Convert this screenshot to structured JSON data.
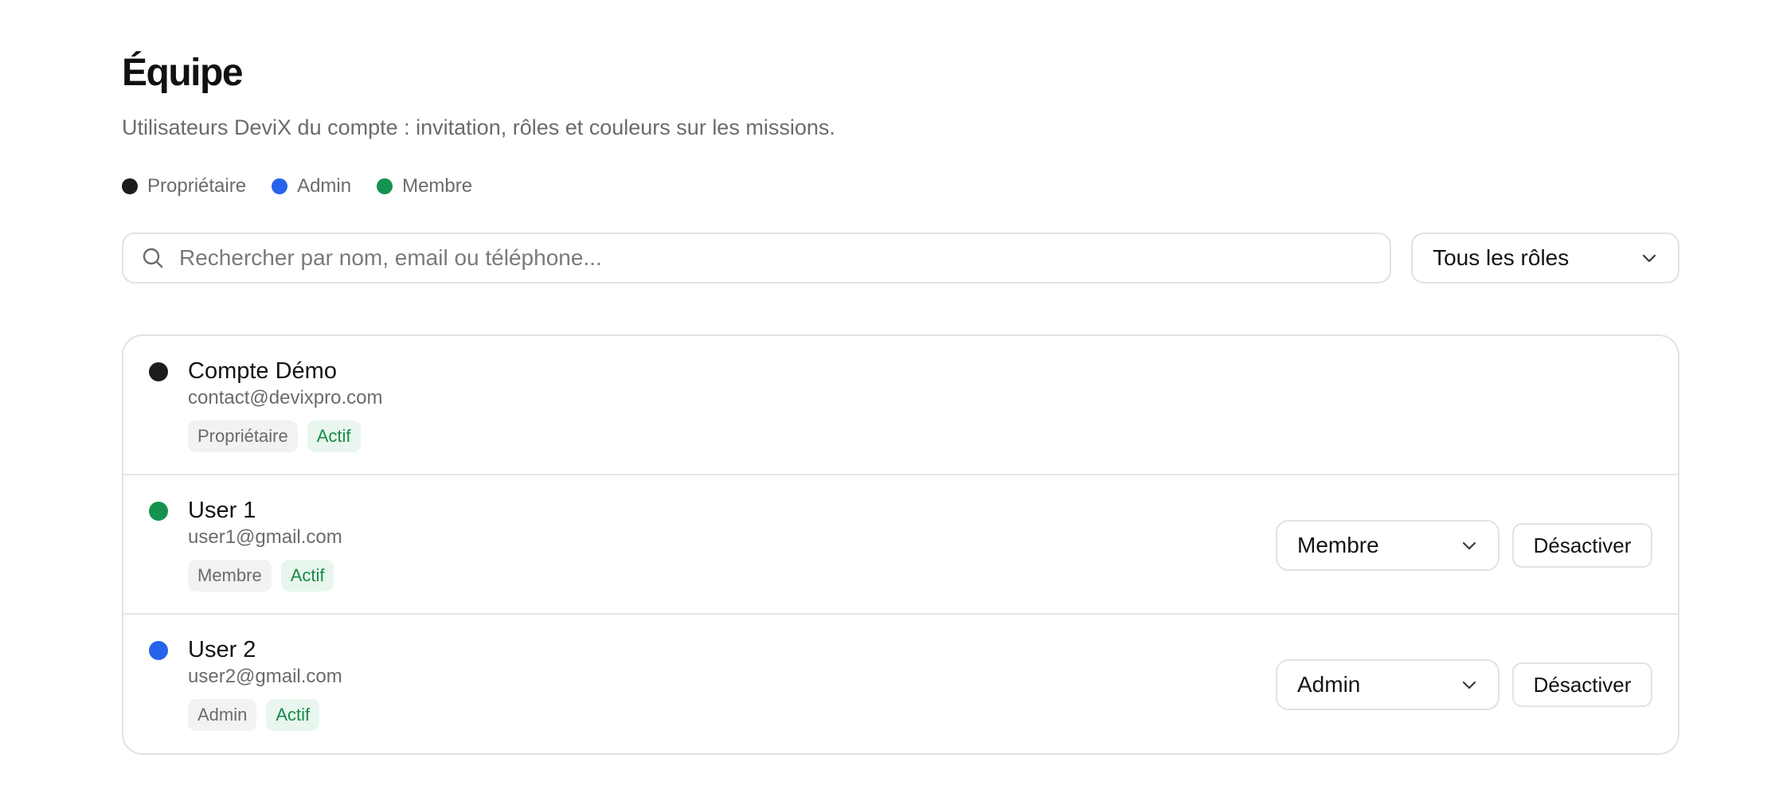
{
  "header": {
    "title": "Équipe",
    "subtitle": "Utilisateurs DeviX du compte : invitation, rôles et couleurs sur les missions."
  },
  "legend": [
    {
      "label": "Propriétaire",
      "color": "#1c1c1c"
    },
    {
      "label": "Admin",
      "color": "#2563eb"
    },
    {
      "label": "Membre",
      "color": "#16924f"
    }
  ],
  "search": {
    "placeholder": "Rechercher par nom, email ou téléphone...",
    "value": "",
    "icon": "search-icon"
  },
  "role_filter": {
    "selected": "Tous les rôles",
    "icon": "chevron-down-icon"
  },
  "members": [
    {
      "name": "Compte Démo",
      "email": "contact@devixpro.com",
      "role_badge": "Propriétaire",
      "status_badge": "Actif",
      "color": "#1c1c1c"
    },
    {
      "name": "User 1",
      "email": "user1@gmail.com",
      "role_badge": "Membre",
      "status_badge": "Actif",
      "color": "#16924f",
      "role_select": "Membre",
      "action_label": "Désactiver"
    },
    {
      "name": "User 2",
      "email": "user2@gmail.com",
      "role_badge": "Admin",
      "status_badge": "Actif",
      "color": "#2563eb",
      "role_select": "Admin",
      "action_label": "Désactiver"
    }
  ],
  "colors": {
    "accent_green": "#198a47",
    "badge_status_bg": "#e8f6ee",
    "border": "#e2e2e2"
  }
}
